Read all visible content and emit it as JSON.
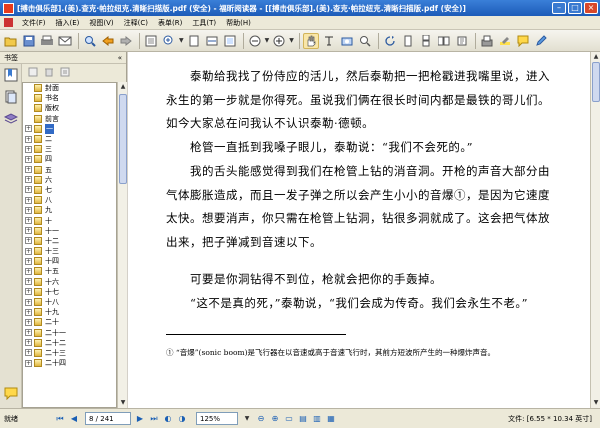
{
  "window": {
    "title": "[搏击俱乐部].(美).查克·帕拉纽克.清晰扫描版.pdf (安全) - 福昕阅读器 - [[搏击俱乐部].(美).查克·帕拉纽克.清晰扫描版.pdf (安全)]"
  },
  "menu": {
    "items": [
      "文件(F)",
      "插入(E)",
      "视图(V)",
      "注释(C)",
      "表单(R)",
      "工具(T)",
      "帮助(H)"
    ]
  },
  "sidebar": {
    "title": "书签",
    "collapse_glyph": "«",
    "bookmarks": [
      "封面",
      "书名",
      "版权",
      "前言",
      "一",
      "二",
      "三",
      "四",
      "五",
      "六",
      "七",
      "八",
      "九",
      "十",
      "十一",
      "十二",
      "十三",
      "十四",
      "十五",
      "十六",
      "十七",
      "十八",
      "十九",
      "二十",
      "二十一",
      "二十二",
      "二十三",
      "二十四"
    ],
    "selected_index": 4
  },
  "document": {
    "paragraphs": [
      "　　泰勒给我找了份侍应的活儿，然后泰勒把一把枪戳进我嘴里说，进入永生的第一步就是你得死。虽说我们俩在很长时间内都是最铁的哥儿们。如今大家总在问我认不认识泰勒·德顿。",
      "　　枪管一直抵到我嗓子眼儿，泰勒说：“我们不会死的。”",
      "　　我的舌头能感觉得到我们在枪管上钻的消音洞。开枪的声音大部分由气体膨胀造成，而且一发子弹之所以会产生小小的音爆①，是因为它速度太快。想要消声，你只需在枪管上钻洞，钻很多洞就成了。这会把气体放出来，把子弹减到音速以下。",
      "　　可要是你洞钻得不到位，枪就会把你的手轰掉。",
      "　　“这不是真的死，”泰勒说，“我们会成为传奇。我们会永生不老。”"
    ],
    "footnote": "① “音爆”(sonic boom)是飞行器在以音速或高于音速飞行时，其前方短波所产生的一种爆炸声音。"
  },
  "status": {
    "ready": "就绪",
    "page_current": "8 / 241",
    "zoom": "125%",
    "file_size": "文件: [6.55 * 10.34 英寸]"
  }
}
